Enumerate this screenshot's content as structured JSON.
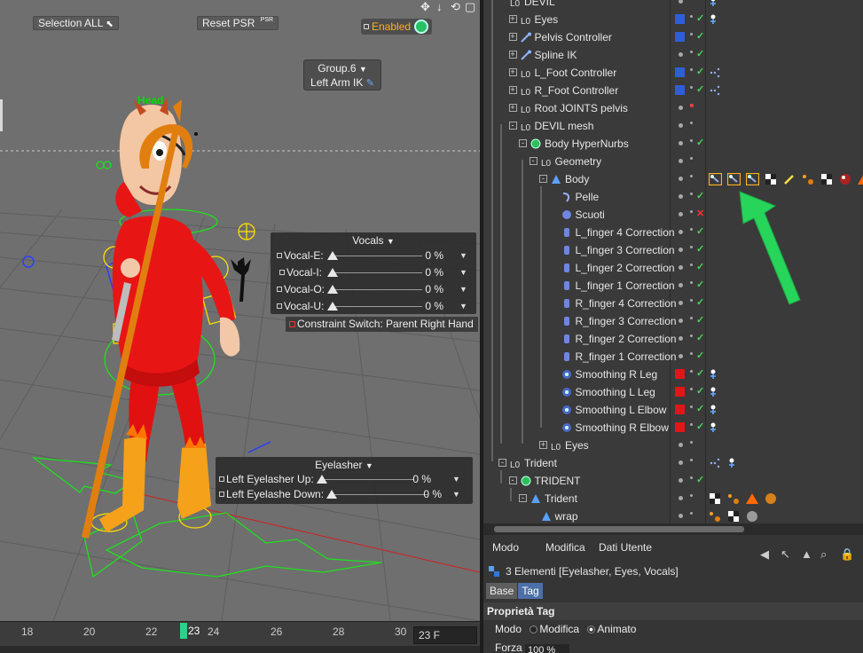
{
  "viewport": {
    "selection_all": "Selection ALL",
    "reset_psr": "Reset PSR",
    "psr_badge": "PSR",
    "enabled": "Enabled",
    "group": "Group.6",
    "left_arm_ik": "Left Arm IK",
    "head_label": "Head",
    "vocals": {
      "title": "Vocals",
      "rows": [
        {
          "label": "Vocal-E:",
          "value": "0 %"
        },
        {
          "label": "Vocal-I:",
          "value": "0 %"
        },
        {
          "label": "Vocal-O:",
          "value": "0 %"
        },
        {
          "label": "Vocal-U:",
          "value": "0 %"
        }
      ]
    },
    "constraint_switch": "Constraint Switch:  Parent Right Hand",
    "eyelasher": {
      "title": "Eyelasher",
      "rows": [
        {
          "label": "Left Eyelasher Up:",
          "value": "0 %"
        },
        {
          "label": "Left Eyelashe Down:",
          "value": "0 %"
        }
      ]
    }
  },
  "timeline": {
    "ticks": [
      "18",
      "20",
      "22",
      "24",
      "26",
      "28",
      "30"
    ],
    "current_frame": "23",
    "frame_field": "23 F"
  },
  "object_manager": {
    "rows": [
      {
        "name": "DEVIL",
        "indent": 0,
        "icon": "null"
      },
      {
        "name": "Eyes",
        "indent": 1,
        "icon": "null",
        "exp": "+"
      },
      {
        "name": "Pelvis Controller",
        "indent": 1,
        "icon": "bone",
        "exp": "+"
      },
      {
        "name": "Spline IK",
        "indent": 1,
        "icon": "bone",
        "exp": "+"
      },
      {
        "name": "L_Foot Controller",
        "indent": 1,
        "icon": "null",
        "exp": "+"
      },
      {
        "name": "R_Foot Controller",
        "indent": 1,
        "icon": "null",
        "exp": "+"
      },
      {
        "name": "Root JOINTS  pelvis",
        "indent": 1,
        "icon": "null",
        "exp": "+"
      },
      {
        "name": "DEVIL mesh",
        "indent": 1,
        "icon": "null",
        "exp": "-"
      },
      {
        "name": "Body HyperNurbs",
        "indent": 2,
        "icon": "hypernurbs",
        "exp": "-"
      },
      {
        "name": "Geometry",
        "indent": 3,
        "icon": "null",
        "exp": "-"
      },
      {
        "name": "Body",
        "indent": 4,
        "icon": "polygon",
        "exp": "-"
      },
      {
        "name": "Pelle",
        "indent": 5,
        "icon": "deformer"
      },
      {
        "name": "Scuoti",
        "indent": 5,
        "icon": "sphere"
      },
      {
        "name": "L_finger 4 Correction",
        "indent": 5,
        "icon": "morph"
      },
      {
        "name": "L_finger 3 Correction",
        "indent": 5,
        "icon": "morph"
      },
      {
        "name": "L_finger 2 Correction",
        "indent": 5,
        "icon": "morph"
      },
      {
        "name": "L_finger 1 Correction",
        "indent": 5,
        "icon": "morph"
      },
      {
        "name": "R_finger 4 Correction",
        "indent": 5,
        "icon": "morph"
      },
      {
        "name": "R_finger 3 Correction",
        "indent": 5,
        "icon": "morph"
      },
      {
        "name": "R_finger 2 Correction",
        "indent": 5,
        "icon": "morph"
      },
      {
        "name": "R_finger 1 Correction",
        "indent": 5,
        "icon": "morph"
      },
      {
        "name": "Smoothing R Leg",
        "indent": 5,
        "icon": "smooth"
      },
      {
        "name": "Smoothing L Leg",
        "indent": 5,
        "icon": "smooth"
      },
      {
        "name": "Smoothing L Elbow",
        "indent": 5,
        "icon": "smooth"
      },
      {
        "name": "Smoothing R Elbow",
        "indent": 5,
        "icon": "smooth"
      },
      {
        "name": "Eyes",
        "indent": 4,
        "icon": "null",
        "exp": "+"
      },
      {
        "name": "Trident",
        "indent": 0,
        "icon": "null",
        "exp": "-"
      },
      {
        "name": "TRIDENT",
        "indent": 1,
        "icon": "hypernurbs",
        "exp": "-"
      },
      {
        "name": "Trident",
        "indent": 2,
        "icon": "polygon",
        "exp": "-"
      },
      {
        "name": "wrap",
        "indent": 3,
        "icon": "polygon"
      }
    ]
  },
  "attribute_manager": {
    "menu": [
      "Modo",
      "Modifica",
      "Dati Utente"
    ],
    "info": "3 Elementi [Eyelasher, Eyes, Vocals]",
    "tabs": [
      "Base",
      "Tag"
    ],
    "section": "Proprietà Tag",
    "mode_label": "Modo",
    "mode_options": [
      "Modifica",
      "Animato"
    ],
    "mode_selected": "Animato",
    "forza_label": "Forza",
    "forza_value": "100 %"
  },
  "colors": {
    "accent_green": "#27d55b",
    "check_green": "#4cd25a",
    "blue_swatch": "#2d5fd6",
    "red_swatch": "#e21616",
    "enabled_orange": "#ffb020",
    "tab_active": "#4d6fa8"
  }
}
